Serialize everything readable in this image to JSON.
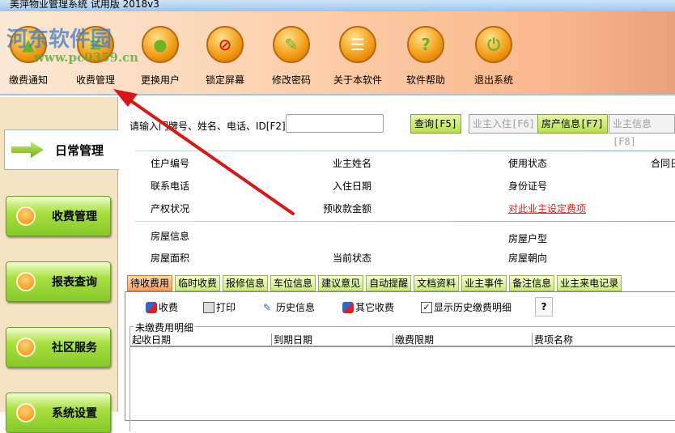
{
  "window": {
    "title": "美萍物业管理系统 试用版 2018v3"
  },
  "watermark": {
    "name": "河东软件园",
    "url": "www.pc0359.cn"
  },
  "toolbar": [
    {
      "label": "缴费通知",
      "icon": "notice-icon"
    },
    {
      "label": "收费管理",
      "icon": "document-icon"
    },
    {
      "label": "更换用户",
      "icon": "user-icon"
    },
    {
      "label": "锁定屏幕",
      "icon": "lock-screen-icon"
    },
    {
      "label": "修改密码",
      "icon": "wrench-icon"
    },
    {
      "label": "关于本软件",
      "icon": "about-icon"
    },
    {
      "label": "软件帮助",
      "icon": "help-icon"
    },
    {
      "label": "退出系统",
      "icon": "power-icon"
    }
  ],
  "sidebar": {
    "active": "日常管理",
    "items": [
      "收费管理",
      "报表查询",
      "社区服务",
      "系统设置"
    ]
  },
  "search": {
    "label": "请输入门牌号、姓名、电话、ID[F2]",
    "value": "",
    "buttons": {
      "query": "查询[F5]",
      "checkin": "业主入住[F6]",
      "property": "房产信息[F7]",
      "owner": "业主信息[F8]"
    }
  },
  "info": {
    "resident_no": "住户编号",
    "owner_name": "业主姓名",
    "use_status": "使用状态",
    "contract": "合同日",
    "phone": "联系电话",
    "checkin_date": "入住日期",
    "id_no": "身份证号",
    "ownership": "产权状况",
    "prepaid": "预收款金额",
    "set_fees_link": "对此业主设定费项",
    "house_info": "房屋信息",
    "house_type": "房屋户型",
    "area": "房屋面积",
    "current_status": "当前状态",
    "orientation": "房屋朝向"
  },
  "tabs": [
    "待收费用",
    "临时收费",
    "报修信息",
    "车位信息",
    "建议意见",
    "自动提醒",
    "文档资料",
    "业主事件",
    "备注信息",
    "业主来电记录"
  ],
  "actions": {
    "charge": "收费",
    "print": "打印",
    "history": "历史信息",
    "other": "其它收费",
    "show_history": "显示历史缴费明细",
    "help": "?"
  },
  "table": {
    "title": "未缴费用明细",
    "columns": [
      "起收日期",
      "到期日期",
      "缴费限期",
      "费项名称"
    ]
  }
}
